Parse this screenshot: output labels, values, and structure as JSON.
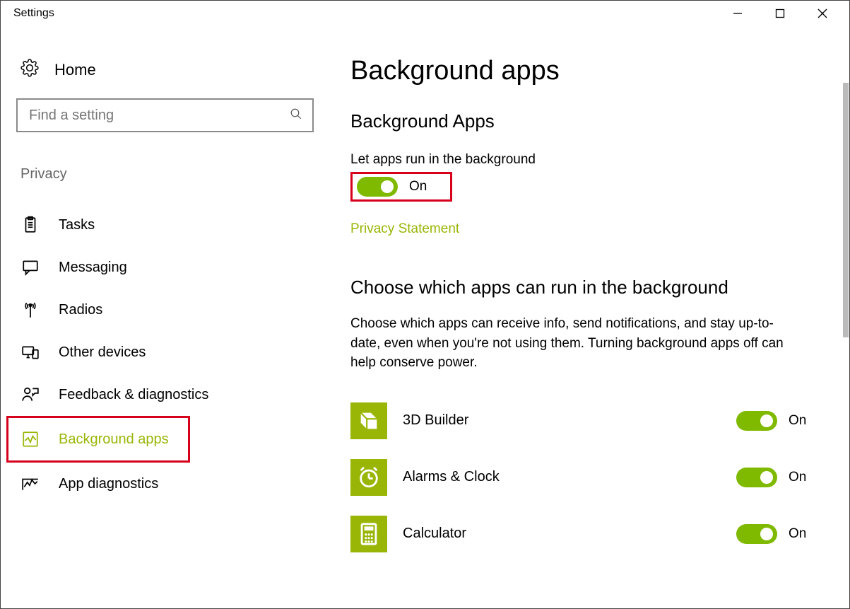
{
  "window": {
    "title": "Settings"
  },
  "sidebar": {
    "home_label": "Home",
    "search_placeholder": "Find a setting",
    "section_label": "Privacy",
    "items": [
      {
        "label": "Tasks"
      },
      {
        "label": "Messaging"
      },
      {
        "label": "Radios"
      },
      {
        "label": "Other devices"
      },
      {
        "label": "Feedback & diagnostics"
      },
      {
        "label": "Background apps"
      },
      {
        "label": "App diagnostics"
      }
    ]
  },
  "main": {
    "page_title": "Background apps",
    "section1_heading": "Background Apps",
    "master_label": "Let apps run in the background",
    "master_state": "On",
    "privacy_link": "Privacy Statement",
    "section2_heading": "Choose which apps can run in the background",
    "section2_desc": "Choose which apps can receive info, send notifications, and stay up-to-date, even when you're not using them. Turning background apps off can help conserve power.",
    "apps": [
      {
        "name": "3D Builder",
        "state": "On"
      },
      {
        "name": "Alarms & Clock",
        "state": "On"
      },
      {
        "name": "Calculator",
        "state": "On"
      }
    ]
  },
  "colors": {
    "accent": "#99b607",
    "toggle_on": "#7fba00",
    "highlight": "#d6001c"
  }
}
